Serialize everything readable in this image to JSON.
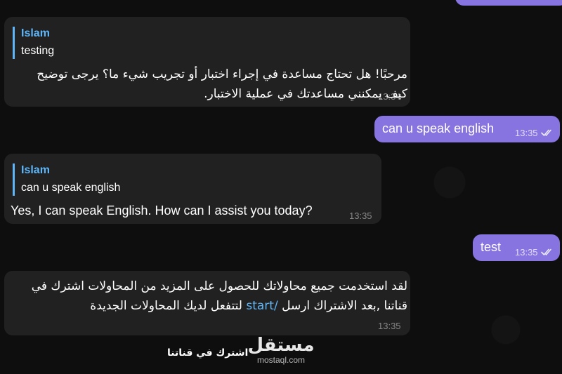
{
  "messages": [
    {
      "direction": "incoming",
      "reply": {
        "name": "Islam",
        "text": "testing"
      },
      "text": "مرحبًا! هل تحتاج مساعدة في إجراء اختبار أو تجريب شيء ما؟ يرجى توضيح كيف يمكنني مساعدتك في عملية الاختبار.",
      "time": "13:34"
    },
    {
      "direction": "outgoing",
      "text": "can u speak english",
      "time": "13:35",
      "status": "read"
    },
    {
      "direction": "incoming",
      "reply": {
        "name": "Islam",
        "text": "can u speak english"
      },
      "text": "Yes, I can speak English. How can I assist you today?",
      "time": "13:35"
    },
    {
      "direction": "outgoing",
      "text": "test",
      "time": "13:35",
      "status": "read"
    },
    {
      "direction": "incoming",
      "text_before": "لقد استخدمت جميع محاولاتك للحصول على المزيد من المحاولات اشترك في قناتنا ,بعد الاشتراك ارسل ",
      "command": "/start",
      "text_after": " لتتفعل لديك المحاولات الجديدة",
      "time": "13:35"
    }
  ],
  "footer_button": "اشترك في قناتنا",
  "watermark": {
    "logo": "مستقل",
    "site": "mostaql.com"
  },
  "colors": {
    "background": "#0e0e0e",
    "incoming_bubble": "#212121",
    "outgoing_bubble": "#8774e1",
    "reply_accent": "#5eb5f7",
    "link": "#5eb5f7"
  },
  "icons": [
    "double-check-icon"
  ]
}
